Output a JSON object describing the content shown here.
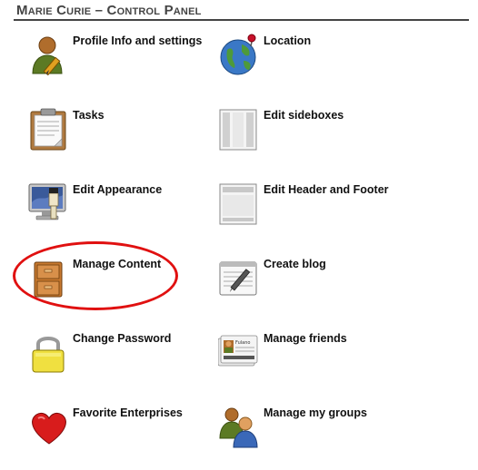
{
  "panel": {
    "title": "Marie Curie – Control Panel"
  },
  "items": {
    "profile": {
      "label": "Profile Info and settings",
      "icon": "user-edit-icon"
    },
    "location": {
      "label": "Location",
      "icon": "globe-pin-icon"
    },
    "tasks": {
      "label": "Tasks",
      "icon": "clipboard-icon"
    },
    "sideboxes": {
      "label": "Edit sideboxes",
      "icon": "sideboxes-icon"
    },
    "appearance": {
      "label": "Edit Appearance",
      "icon": "monitor-paint-icon"
    },
    "header_footer": {
      "label": "Edit Header and Footer",
      "icon": "header-footer-icon"
    },
    "manage_content": {
      "label": "Manage Content",
      "icon": "filing-cabinet-icon"
    },
    "create_blog": {
      "label": "Create blog",
      "icon": "notepad-pen-icon"
    },
    "change_password": {
      "label": "Change Password",
      "icon": "padlock-icon"
    },
    "manage_friends": {
      "label": "Manage friends",
      "icon": "contact-cards-icon"
    },
    "favorite_enterprises": {
      "label": "Favorite Enterprises",
      "icon": "heart-icon"
    },
    "manage_groups": {
      "label": "Manage my groups",
      "icon": "group-icon"
    }
  },
  "friend_card": {
    "name": "Fulano"
  },
  "colors": {
    "highlight": "#e01010",
    "title": "#444444"
  }
}
